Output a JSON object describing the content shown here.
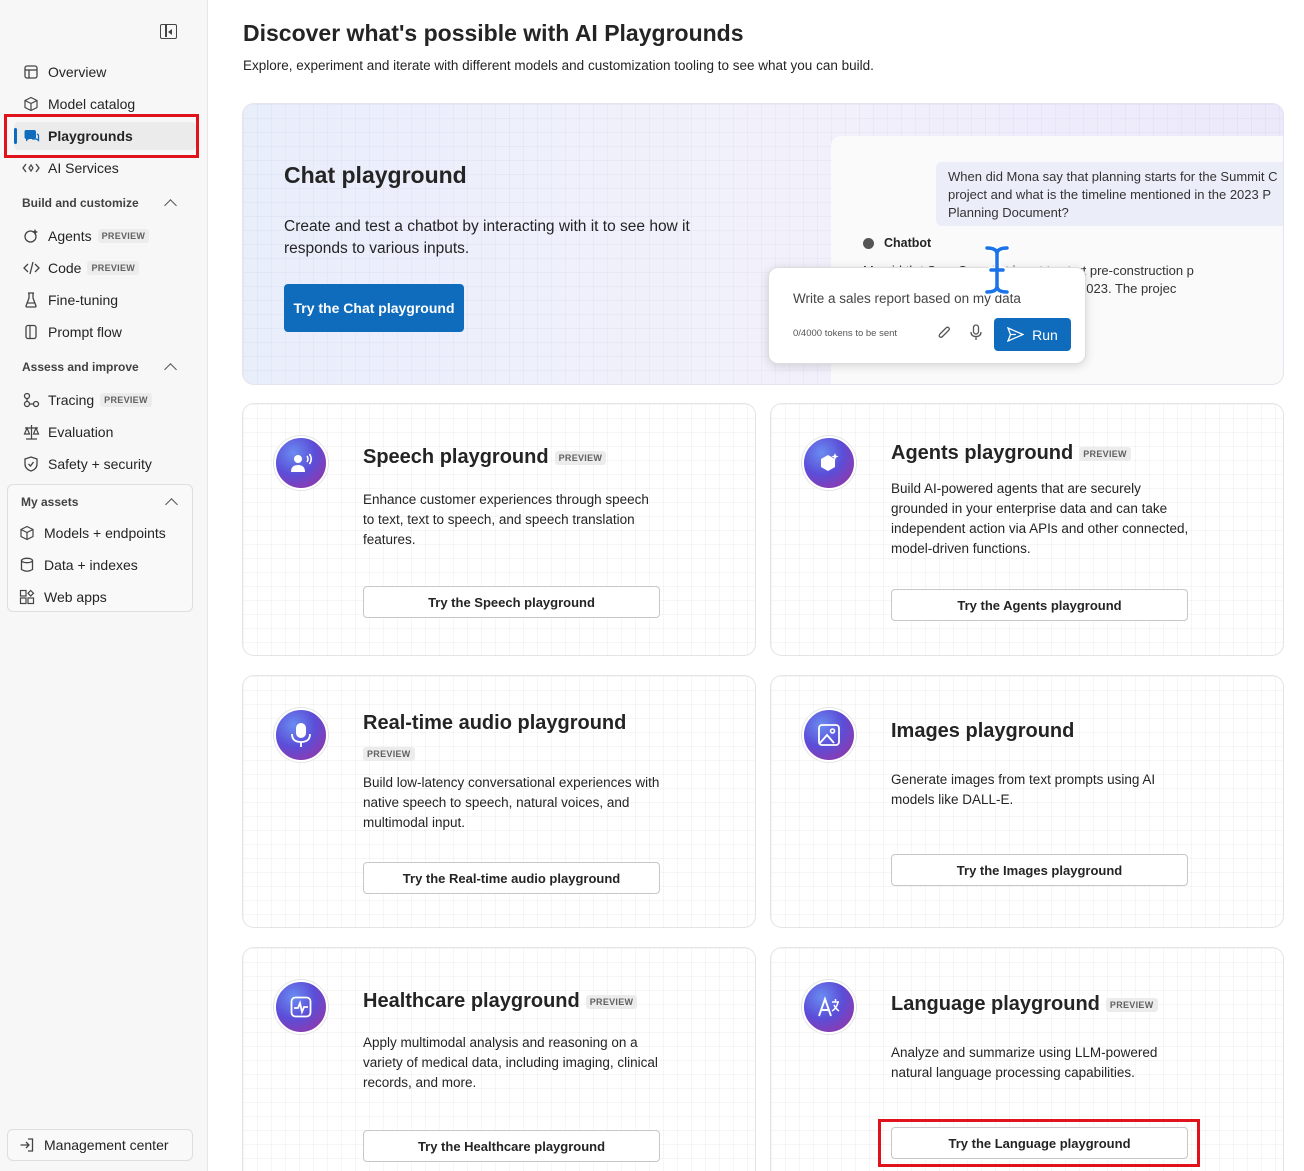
{
  "sidebar": {
    "nav": [
      {
        "label": "Overview",
        "icon": "home-icon"
      },
      {
        "label": "Model catalog",
        "icon": "cube-icon"
      },
      {
        "label": "Playgrounds",
        "icon": "chat-bubbles-icon"
      },
      {
        "label": "AI Services",
        "icon": "ai-services-icon"
      }
    ],
    "build_section": "Build and customize",
    "build_items": [
      {
        "label": "Agents",
        "badge": "PREVIEW"
      },
      {
        "label": "Code",
        "badge": "PREVIEW"
      },
      {
        "label": "Fine-tuning"
      },
      {
        "label": "Prompt flow"
      }
    ],
    "assess_section": "Assess and improve",
    "assess_items": [
      {
        "label": "Tracing",
        "badge": "PREVIEW"
      },
      {
        "label": "Evaluation"
      },
      {
        "label": "Safety + security"
      }
    ],
    "assets_section": "My assets",
    "assets_items": [
      {
        "label": "Models + endpoints"
      },
      {
        "label": "Data + indexes"
      },
      {
        "label": "Web apps"
      }
    ],
    "management": "Management center"
  },
  "main": {
    "title": "Discover what's possible with AI Playgrounds",
    "subtitle": "Explore, experiment and iterate with different models and customization tooling to see what you can build.",
    "hero": {
      "title": "Chat playground",
      "description": "Create and test a chatbot by interacting with it to see how it responds to various inputs.",
      "button": "Try the Chat playground",
      "user_msg_line1": "When did Mona say that planning starts for the Summit C",
      "user_msg_line2": "project and what is the timeline mentioned in the 2023 P",
      "user_msg_line3": "Planning Document?",
      "chatbot_label": "Chatbot",
      "bot_line1": "M     id th t S      C       j ct is set to start pre-construction p",
      "bot_line2": "                                 a in Atlanta April 2023. The projec",
      "composer_text": "Write a sales report based on my data",
      "composer_hint": "0/4000 tokens to be sent",
      "run": "Run"
    },
    "cards": [
      {
        "title": "Speech playground",
        "badge": "PREVIEW",
        "description": "Enhance customer experiences through speech to text, text to speech, and speech translation features.",
        "button": "Try the Speech playground",
        "icon": "speech-person-icon"
      },
      {
        "title": "Agents playground",
        "badge": "PREVIEW",
        "description": "Build AI-powered agents that are securely grounded in your enterprise data and can take independent action via APIs and other connected, model-driven functions.",
        "button": "Try the Agents playground",
        "icon": "agent-hexagon-icon"
      },
      {
        "title": "Real-time audio playground",
        "badge": "PREVIEW",
        "description": "Build low-latency conversational experiences with native speech to speech, natural voices, and multimodal input.",
        "button": "Try the Real-time audio playground",
        "icon": "microphone-icon"
      },
      {
        "title": "Images playground",
        "badge": "",
        "description": "Generate images from text prompts using AI models like DALL-E.",
        "button": "Try the Images playground",
        "icon": "image-icon"
      },
      {
        "title": "Healthcare playground",
        "badge": "PREVIEW",
        "description": "Apply multimodal analysis and reasoning on a variety of medical data, including imaging, clinical records, and more.",
        "button": "Try the Healthcare playground",
        "icon": "heart-pulse-icon"
      },
      {
        "title": "Language playground",
        "badge": "PREVIEW",
        "description": "Analyze and summarize using LLM-powered natural language processing capabilities.",
        "button": "Try the Language playground",
        "icon": "language-icon"
      }
    ]
  },
  "colors": {
    "accent": "#0f6cbd",
    "highlight": "#e0131c"
  }
}
